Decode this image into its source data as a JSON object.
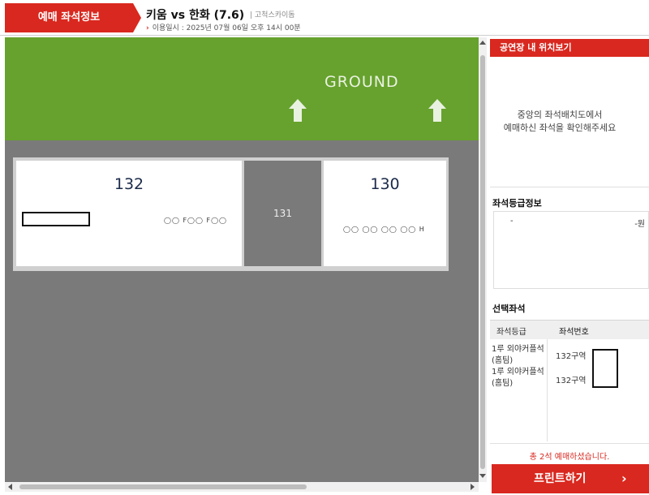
{
  "header": {
    "tab_label": "예매 좌석정보",
    "match_title": "키움 vs 한화 (7.6)",
    "venue": "| 고척스카이돔",
    "datetime": "이용일시 : 2025년 07월 06일 오후 14시 00분"
  },
  "map": {
    "ground_label": "GROUND",
    "sections": [
      {
        "number": "132",
        "seat_row": "◯◯ F◯◯ F◯◯"
      },
      {
        "number": "131"
      },
      {
        "number": "130",
        "seat_row": "◯◯  ◯◯  ◯◯  ◯◯ H"
      }
    ]
  },
  "panel": {
    "header_title": "공연장 내 위치보기",
    "message_lines": [
      "중앙의 좌석배치도에서",
      "예매하신 좌석을 확인해주세요"
    ],
    "grade_info": {
      "title": "좌석등급정보",
      "grade": "-",
      "price": "-원"
    },
    "selected": {
      "title": "선택좌석",
      "col_grade": "좌석등급",
      "col_seat": "좌석번호",
      "rows": [
        {
          "grade_line1": "1루 외야커플석",
          "grade_line2": "(홈팀)",
          "seat": "132구역"
        },
        {
          "grade_line1": "1루 외야커플석",
          "grade_line2": "(홈팀)",
          "seat": "132구역"
        }
      ]
    },
    "summary": "총 2석 예매하셨습니다.",
    "print_label": "프린트하기",
    "print_chevron": "›"
  },
  "colors": {
    "accent": "#d9281f",
    "ground": "#66a22d",
    "stands": "#7a7a7a",
    "section_number": "#1b2a4a"
  }
}
